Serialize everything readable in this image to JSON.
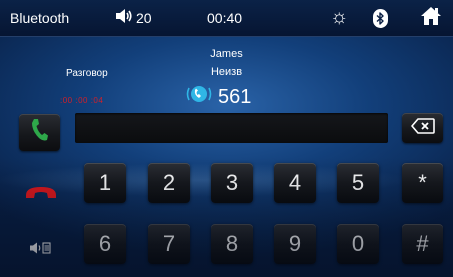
{
  "statusbar": {
    "title": "Bluetooth",
    "volume": "20",
    "time": "00:40",
    "icons": [
      "speaker-icon",
      "brightness-icon",
      "bluetooth-icon",
      "home-icon"
    ]
  },
  "call": {
    "state": "Разговор",
    "timer": ":00 :00 :04",
    "caller_name": "James",
    "caller_label": "Неизв",
    "number": "561"
  },
  "input": {
    "value": ""
  },
  "keypad": {
    "row1": [
      "1",
      "2",
      "3",
      "4",
      "5",
      "*"
    ],
    "row2": [
      "6",
      "7",
      "8",
      "9",
      "0",
      "#"
    ]
  },
  "colors": {
    "background": "#123f7a",
    "answer": "#2ea84a",
    "hangup": "#e0181e",
    "timer": "#d0202a",
    "contact_icon": "#2fb6e6"
  }
}
